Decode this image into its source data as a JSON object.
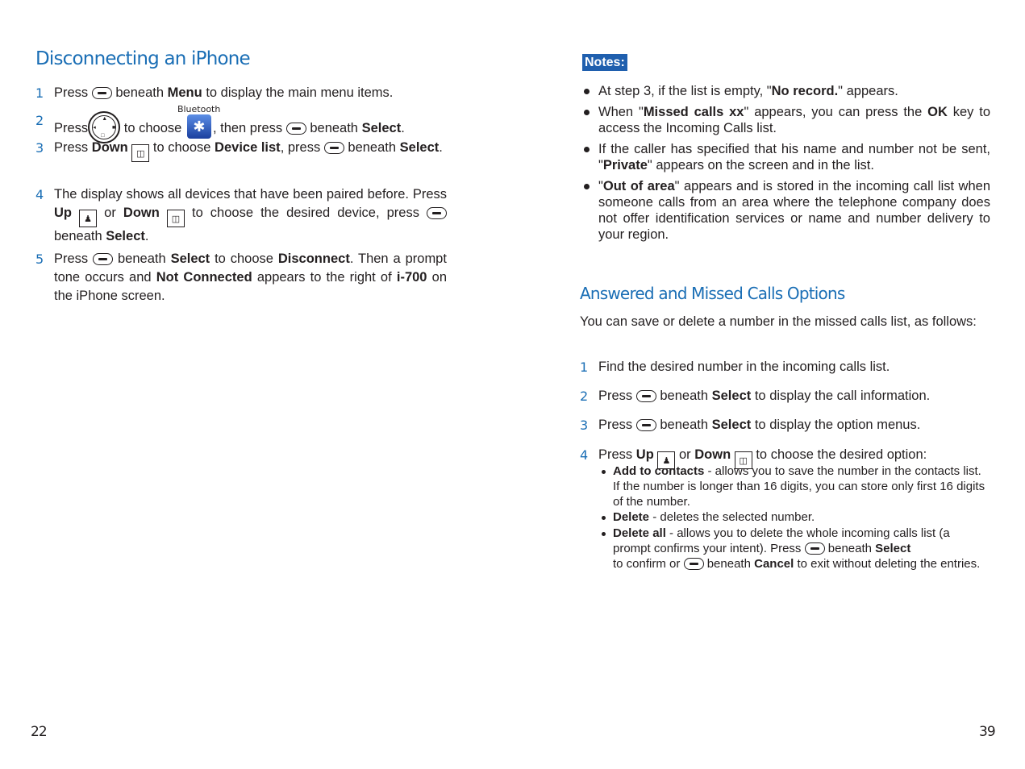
{
  "left_page": {
    "title": "Disconnecting an iPhone",
    "page_number": "22",
    "bluetooth_label": "Bluetooth",
    "steps": [
      {
        "num": "1",
        "press": "Press",
        "t1": "beneath",
        "menu": "Menu",
        "t2": "to display the main menu items."
      },
      {
        "num": "2",
        "press": "Press",
        "t1": "to choose",
        "t2": ", then press",
        "t3": "beneath",
        "select": "Select",
        "end": "."
      },
      {
        "num": "3",
        "press": "Press",
        "down": "Down",
        "t1": "to choose",
        "device_list": "Device list",
        "t2": ", press",
        "t3": "beneath",
        "select": "Select",
        "end": "."
      },
      {
        "num": "4",
        "t1": "The display shows all devices that have been paired before. Press",
        "up": "Up",
        "or": "or",
        "down": "Down",
        "t2": "to choose the desired device, press",
        "t3": "beneath",
        "select": "Select",
        "end": "."
      },
      {
        "num": "5",
        "press": "Press",
        "t1": "beneath",
        "select": "Select",
        "t2": "to choose",
        "disconnect": "Disconnect",
        "t3": ". Then a prompt tone occurs and",
        "not_connected": "Not Connected",
        "t4": "appears to the right of",
        "model": "i-700",
        "t5": "on the iPhone screen."
      }
    ]
  },
  "right_page": {
    "notes_label": "Notes:",
    "page_number": "39",
    "notes": [
      {
        "pre": "At step 3, if the list is empty, \"",
        "bold": "No record.",
        "post": "\" appears."
      },
      {
        "pre": "When \"",
        "bold": "Missed calls xx",
        "mid": "\" appears, you can press the ",
        "bold2": "OK",
        "post": " key to access the Incoming Calls list."
      },
      {
        "pre": "If the caller has specified that his name and number not be sent, \"",
        "bold": "Private",
        "post": "\" appears on the screen and in the list."
      },
      {
        "pre": "\"",
        "bold": "Out of area",
        "post": "\" appears and is stored in the incoming call list when someone calls from an area where the telephone company does not offer identification services or name and number delivery to your region."
      }
    ],
    "section_title": "Answered and Missed Calls Options",
    "intro": "You can save or delete a number in the missed calls list, as follows:",
    "steps": [
      {
        "num": "1",
        "text": "Find the desired number in the incoming calls list."
      },
      {
        "num": "2",
        "press": "Press",
        "t1": "beneath",
        "select": "Select",
        "t2": "to display the call information."
      },
      {
        "num": "3",
        "press": "Press",
        "t1": "beneath",
        "select": "Select",
        "t2": "to display the option menus."
      },
      {
        "num": "4",
        "press": "Press",
        "up": "Up",
        "or": "or",
        "down": "Down",
        "t2": "to choose the desired option:"
      }
    ],
    "options": [
      {
        "bold": "Add to contacts",
        "text": " - allows you to save the number in the contacts list. If the number is longer than 16 digits, you can store only first 16 digits of the number."
      },
      {
        "bold": "Delete",
        "text": " - deletes the selected number."
      },
      {
        "bold": "Delete all",
        "text": " - allows you to delete the whole incoming calls list (a prompt confirms your intent). Press",
        "t2": "beneath",
        "select": "Select",
        "t3": "to confirm or",
        "t4": "beneath",
        "cancel": "Cancel",
        "t5": "to exit without deleting the entries."
      }
    ],
    "icons": {
      "soft_key": "soft-key-icon",
      "up_key": "up-contacts-key-icon",
      "down_key": "down-phonebook-key-icon",
      "nav_key": "navigation-key-icon",
      "bluetooth": "bluetooth-icon"
    }
  },
  "colors": {
    "heading": "#1a6eb5",
    "notes_badge": "#1f5fae",
    "text": "#231f20"
  }
}
